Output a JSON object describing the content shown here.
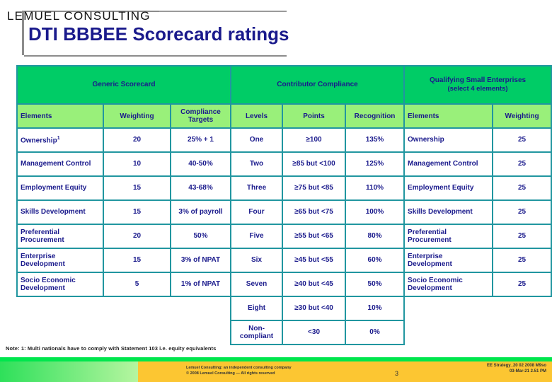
{
  "slide": {
    "title": "DTI BBBEE Scorecard ratings",
    "slide_number": "3"
  },
  "table": {
    "groups": [
      {
        "label": "Generic Scorecard",
        "sub": "",
        "span": 3
      },
      {
        "label": "Contributor Compliance",
        "sub": "",
        "span": 3
      },
      {
        "label": "Qualifying Small Enterprises",
        "sub": "(select 4 elements)",
        "span": 2
      }
    ],
    "columns": [
      "Elements",
      "Weighting",
      "Compliance Targets",
      "Levels",
      "Points",
      "Recognition",
      "Elements",
      "Weighting"
    ],
    "rows": [
      {
        "generic_element": "Ownership",
        "generic_element_sup": "1",
        "weighting": "20",
        "compliance_target": "25% + 1",
        "level": "One",
        "points": "≥100",
        "recognition": "135%",
        "qse_element": "Ownership",
        "qse_weighting": "25"
      },
      {
        "generic_element": "Management Control",
        "generic_element_sup": "",
        "weighting": "10",
        "compliance_target": "40-50%",
        "level": "Two",
        "points": "≥85 but <100",
        "recognition": "125%",
        "qse_element": "Management Control",
        "qse_weighting": "25"
      },
      {
        "generic_element": "Employment Equity",
        "generic_element_sup": "",
        "weighting": "15",
        "compliance_target": "43-68%",
        "level": "Three",
        "points": "≥75 but <85",
        "recognition": "110%",
        "qse_element": "Employment Equity",
        "qse_weighting": "25"
      },
      {
        "generic_element": "Skills Development",
        "generic_element_sup": "",
        "weighting": "15",
        "compliance_target": "3% of payroll",
        "level": "Four",
        "points": "≥65 but <75",
        "recognition": "100%",
        "qse_element": "Skills Development",
        "qse_weighting": "25"
      },
      {
        "generic_element": "Preferential Procurement",
        "generic_element_sup": "",
        "weighting": "20",
        "compliance_target": "50%",
        "level": "Five",
        "points": "≥55 but <65",
        "recognition": "80%",
        "qse_element": "Preferential Procurement",
        "qse_weighting": "25"
      },
      {
        "generic_element": "Enterprise Development",
        "generic_element_sup": "",
        "weighting": "15",
        "compliance_target": "3% of NPAT",
        "level": "Six",
        "points": "≥45 but <55",
        "recognition": "60%",
        "qse_element": "Enterprise Development",
        "qse_weighting": "25"
      },
      {
        "generic_element": "Socio Economic Development",
        "generic_element_sup": "",
        "weighting": "5",
        "compliance_target": "1% of NPAT",
        "level": "Seven",
        "points": "≥40 but <45",
        "recognition": "50%",
        "qse_element": "Socio Economic Development",
        "qse_weighting": "25"
      }
    ],
    "extra_rows": [
      {
        "level": "Eight",
        "points": "≥30 but <40",
        "recognition": "10%"
      },
      {
        "level": "Non-compliant",
        "points": "<30",
        "recognition": "0%"
      }
    ]
  },
  "note": "Note: 1: Multi nationals have to comply with Statement 103 i.e. equity equivalents",
  "footer": {
    "logo": "LEMUEL CONSULTING",
    "copyright_line1": "Lemuel Consulting: an independent consulting company",
    "copyright_line2": "© 2008 Lemuel Consulting — All rights reserved",
    "meta_line1": "EE Strategy_20 02 2008 M9so",
    "meta_line2": "03-Mar-21   2.51 PM"
  },
  "colors": {
    "title_blue": "#1a1a8c",
    "group_green": "#00cc66",
    "header_green": "#99f07a",
    "border_teal": "#2196a0",
    "footer_orange": "#fcc632"
  }
}
